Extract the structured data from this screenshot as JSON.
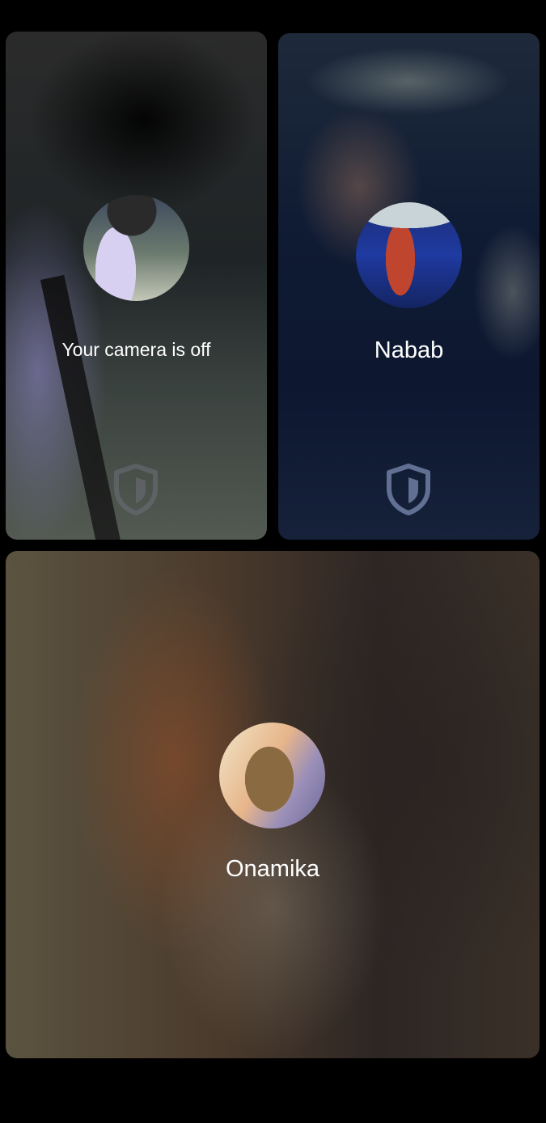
{
  "tiles": {
    "self": {
      "status_text": "Your camera is off",
      "avatar_icon": "user-avatar-icon",
      "shield_icon": "shield-icon"
    },
    "remote": {
      "name": "Nabab",
      "avatar_icon": "user-avatar-icon",
      "shield_icon": "shield-icon"
    },
    "big": {
      "name": "Onamika",
      "avatar_icon": "user-avatar-icon"
    }
  },
  "colors": {
    "background": "#000000",
    "label_text": "#ffffff",
    "shield_stroke_self": "#6f6f7a",
    "shield_stroke_remote": "#6f7fa3"
  }
}
